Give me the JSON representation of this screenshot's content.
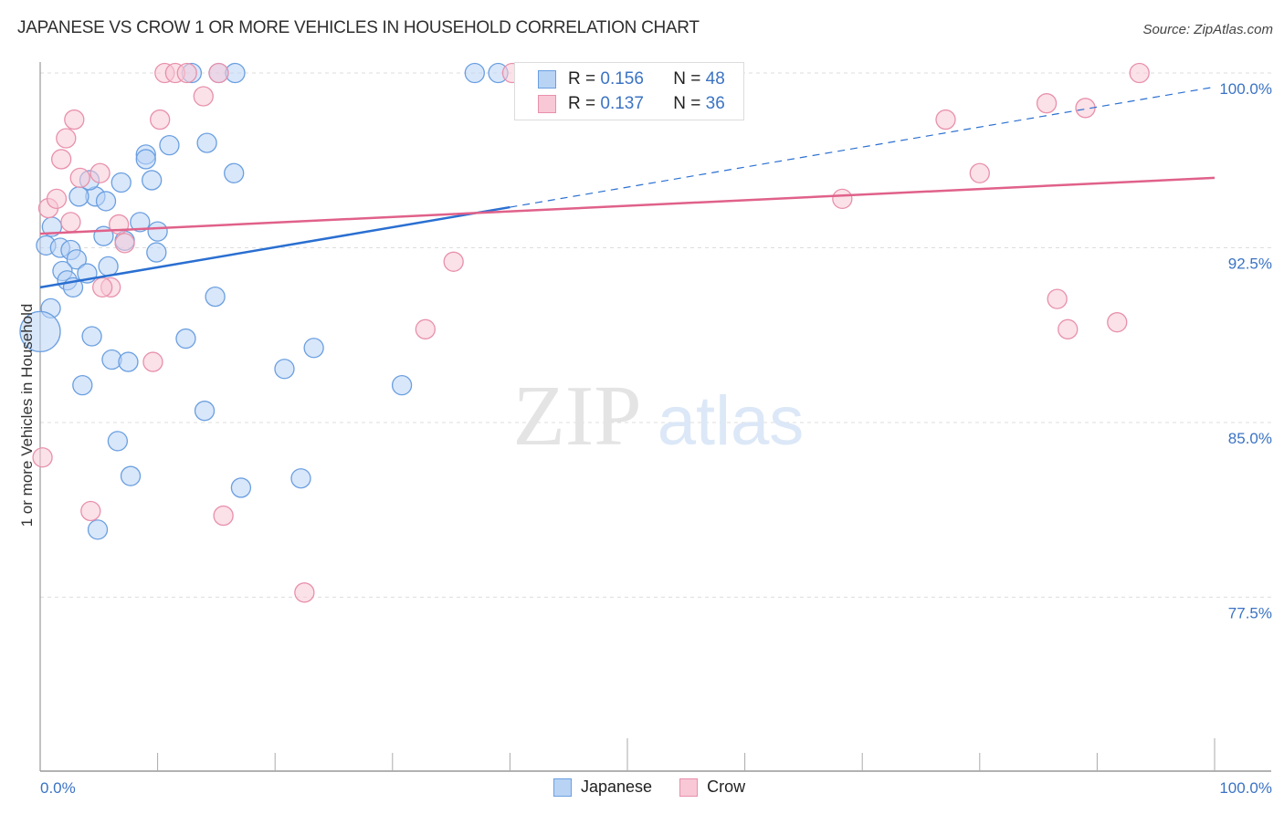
{
  "header": {
    "title": "JAPANESE VS CROW 1 OR MORE VEHICLES IN HOUSEHOLD CORRELATION CHART",
    "source": "Source: ZipAtlas.com"
  },
  "watermark": {
    "zip": "ZIP",
    "atlas": "atlas"
  },
  "legend": {
    "rows": [
      {
        "r_label": "R =",
        "r_value": "0.156",
        "n_label": "N =",
        "n_value": "48"
      },
      {
        "r_label": "R =",
        "r_value": "0.137",
        "n_label": "N =",
        "n_value": "36"
      }
    ]
  },
  "chart_data": {
    "type": "scatter",
    "title": "JAPANESE VS CROW 1 OR MORE VEHICLES IN HOUSEHOLD CORRELATION CHART",
    "xlabel": "",
    "ylabel": "1 or more Vehicles in Household",
    "xlim": [
      0,
      100
    ],
    "ylim": [
      70,
      100.5
    ],
    "x_tick_labels": [
      "0.0%",
      "100.0%"
    ],
    "y_ticks": [
      100,
      92.5,
      85,
      77.5
    ],
    "y_tick_labels": [
      "100.0%",
      "92.5%",
      "85.0%",
      "77.5%"
    ],
    "grid": true,
    "legend_position": "top-center",
    "series": [
      {
        "name": "Japanese",
        "color": "#6a9fe0",
        "fill": "#b9d3f5",
        "line_color": "#2a6fd1",
        "R": 0.156,
        "N": 48,
        "trend": {
          "x0": 0,
          "y0": 90.8,
          "x1": 100,
          "y1": 99.4,
          "solid_until_x": 40
        },
        "points": [
          {
            "x": 12.9,
            "y": 100
          },
          {
            "x": 15.2,
            "y": 100
          },
          {
            "x": 16.6,
            "y": 100
          },
          {
            "x": 37.0,
            "y": 100
          },
          {
            "x": 39.0,
            "y": 100
          },
          {
            "x": 9.0,
            "y": 96.5
          },
          {
            "x": 9.0,
            "y": 96.3
          },
          {
            "x": 11.0,
            "y": 96.9
          },
          {
            "x": 14.2,
            "y": 97.0
          },
          {
            "x": 16.5,
            "y": 95.7
          },
          {
            "x": 9.5,
            "y": 95.4
          },
          {
            "x": 6.9,
            "y": 95.3
          },
          {
            "x": 4.7,
            "y": 94.7
          },
          {
            "x": 3.3,
            "y": 94.7
          },
          {
            "x": 4.2,
            "y": 95.4
          },
          {
            "x": 1.0,
            "y": 93.4
          },
          {
            "x": 8.5,
            "y": 93.6
          },
          {
            "x": 0.5,
            "y": 92.6
          },
          {
            "x": 1.7,
            "y": 92.5
          },
          {
            "x": 2.6,
            "y": 92.4
          },
          {
            "x": 3.1,
            "y": 92.0
          },
          {
            "x": 5.4,
            "y": 93.0
          },
          {
            "x": 7.2,
            "y": 92.8
          },
          {
            "x": 5.8,
            "y": 91.7
          },
          {
            "x": 9.9,
            "y": 92.3
          },
          {
            "x": 1.9,
            "y": 91.5
          },
          {
            "x": 2.3,
            "y": 91.1
          },
          {
            "x": 2.8,
            "y": 90.8
          },
          {
            "x": 4.0,
            "y": 91.4
          },
          {
            "x": 0.9,
            "y": 89.9
          },
          {
            "x": 0.0,
            "y": 88.9,
            "large": true
          },
          {
            "x": 4.4,
            "y": 88.7
          },
          {
            "x": 6.1,
            "y": 87.7
          },
          {
            "x": 7.5,
            "y": 87.6
          },
          {
            "x": 3.6,
            "y": 86.6
          },
          {
            "x": 12.4,
            "y": 88.6
          },
          {
            "x": 14.9,
            "y": 90.4
          },
          {
            "x": 20.8,
            "y": 87.3
          },
          {
            "x": 23.3,
            "y": 88.2
          },
          {
            "x": 30.8,
            "y": 86.6
          },
          {
            "x": 14.0,
            "y": 85.5
          },
          {
            "x": 6.6,
            "y": 84.2
          },
          {
            "x": 7.7,
            "y": 82.7
          },
          {
            "x": 17.1,
            "y": 82.2
          },
          {
            "x": 22.2,
            "y": 82.6
          },
          {
            "x": 4.9,
            "y": 80.4
          },
          {
            "x": 5.6,
            "y": 94.5
          },
          {
            "x": 10.0,
            "y": 93.2
          }
        ]
      },
      {
        "name": "Crow",
        "color": "#e890ab",
        "fill": "#f8c8d6",
        "line_color": "#e0618a",
        "R": 0.137,
        "N": 36,
        "trend": {
          "x0": 0,
          "y0": 93.1,
          "x1": 100,
          "y1": 95.5
        },
        "points": [
          {
            "x": 10.6,
            "y": 100
          },
          {
            "x": 11.5,
            "y": 100
          },
          {
            "x": 12.5,
            "y": 100
          },
          {
            "x": 15.2,
            "y": 100
          },
          {
            "x": 40.2,
            "y": 100
          },
          {
            "x": 56.5,
            "y": 100
          },
          {
            "x": 93.6,
            "y": 100
          },
          {
            "x": 13.9,
            "y": 99.0
          },
          {
            "x": 2.9,
            "y": 98.0
          },
          {
            "x": 2.2,
            "y": 97.2
          },
          {
            "x": 1.8,
            "y": 96.3
          },
          {
            "x": 10.2,
            "y": 98.0
          },
          {
            "x": 3.4,
            "y": 95.5
          },
          {
            "x": 5.1,
            "y": 95.7
          },
          {
            "x": 0.7,
            "y": 94.2
          },
          {
            "x": 1.4,
            "y": 94.6
          },
          {
            "x": 2.6,
            "y": 93.6
          },
          {
            "x": 6.7,
            "y": 93.5
          },
          {
            "x": 7.2,
            "y": 92.7
          },
          {
            "x": 6.0,
            "y": 90.8
          },
          {
            "x": 5.3,
            "y": 90.8
          },
          {
            "x": 0.2,
            "y": 83.5
          },
          {
            "x": 4.3,
            "y": 81.2
          },
          {
            "x": 15.6,
            "y": 81.0
          },
          {
            "x": 22.5,
            "y": 77.7
          },
          {
            "x": 9.6,
            "y": 87.6
          },
          {
            "x": 32.8,
            "y": 89.0
          },
          {
            "x": 35.2,
            "y": 91.9
          },
          {
            "x": 68.3,
            "y": 94.6
          },
          {
            "x": 77.1,
            "y": 98.0
          },
          {
            "x": 85.7,
            "y": 98.7
          },
          {
            "x": 89.0,
            "y": 98.5
          },
          {
            "x": 80.0,
            "y": 95.7
          },
          {
            "x": 86.6,
            "y": 90.3
          },
          {
            "x": 87.5,
            "y": 89.0
          },
          {
            "x": 91.7,
            "y": 89.3
          }
        ]
      }
    ]
  }
}
